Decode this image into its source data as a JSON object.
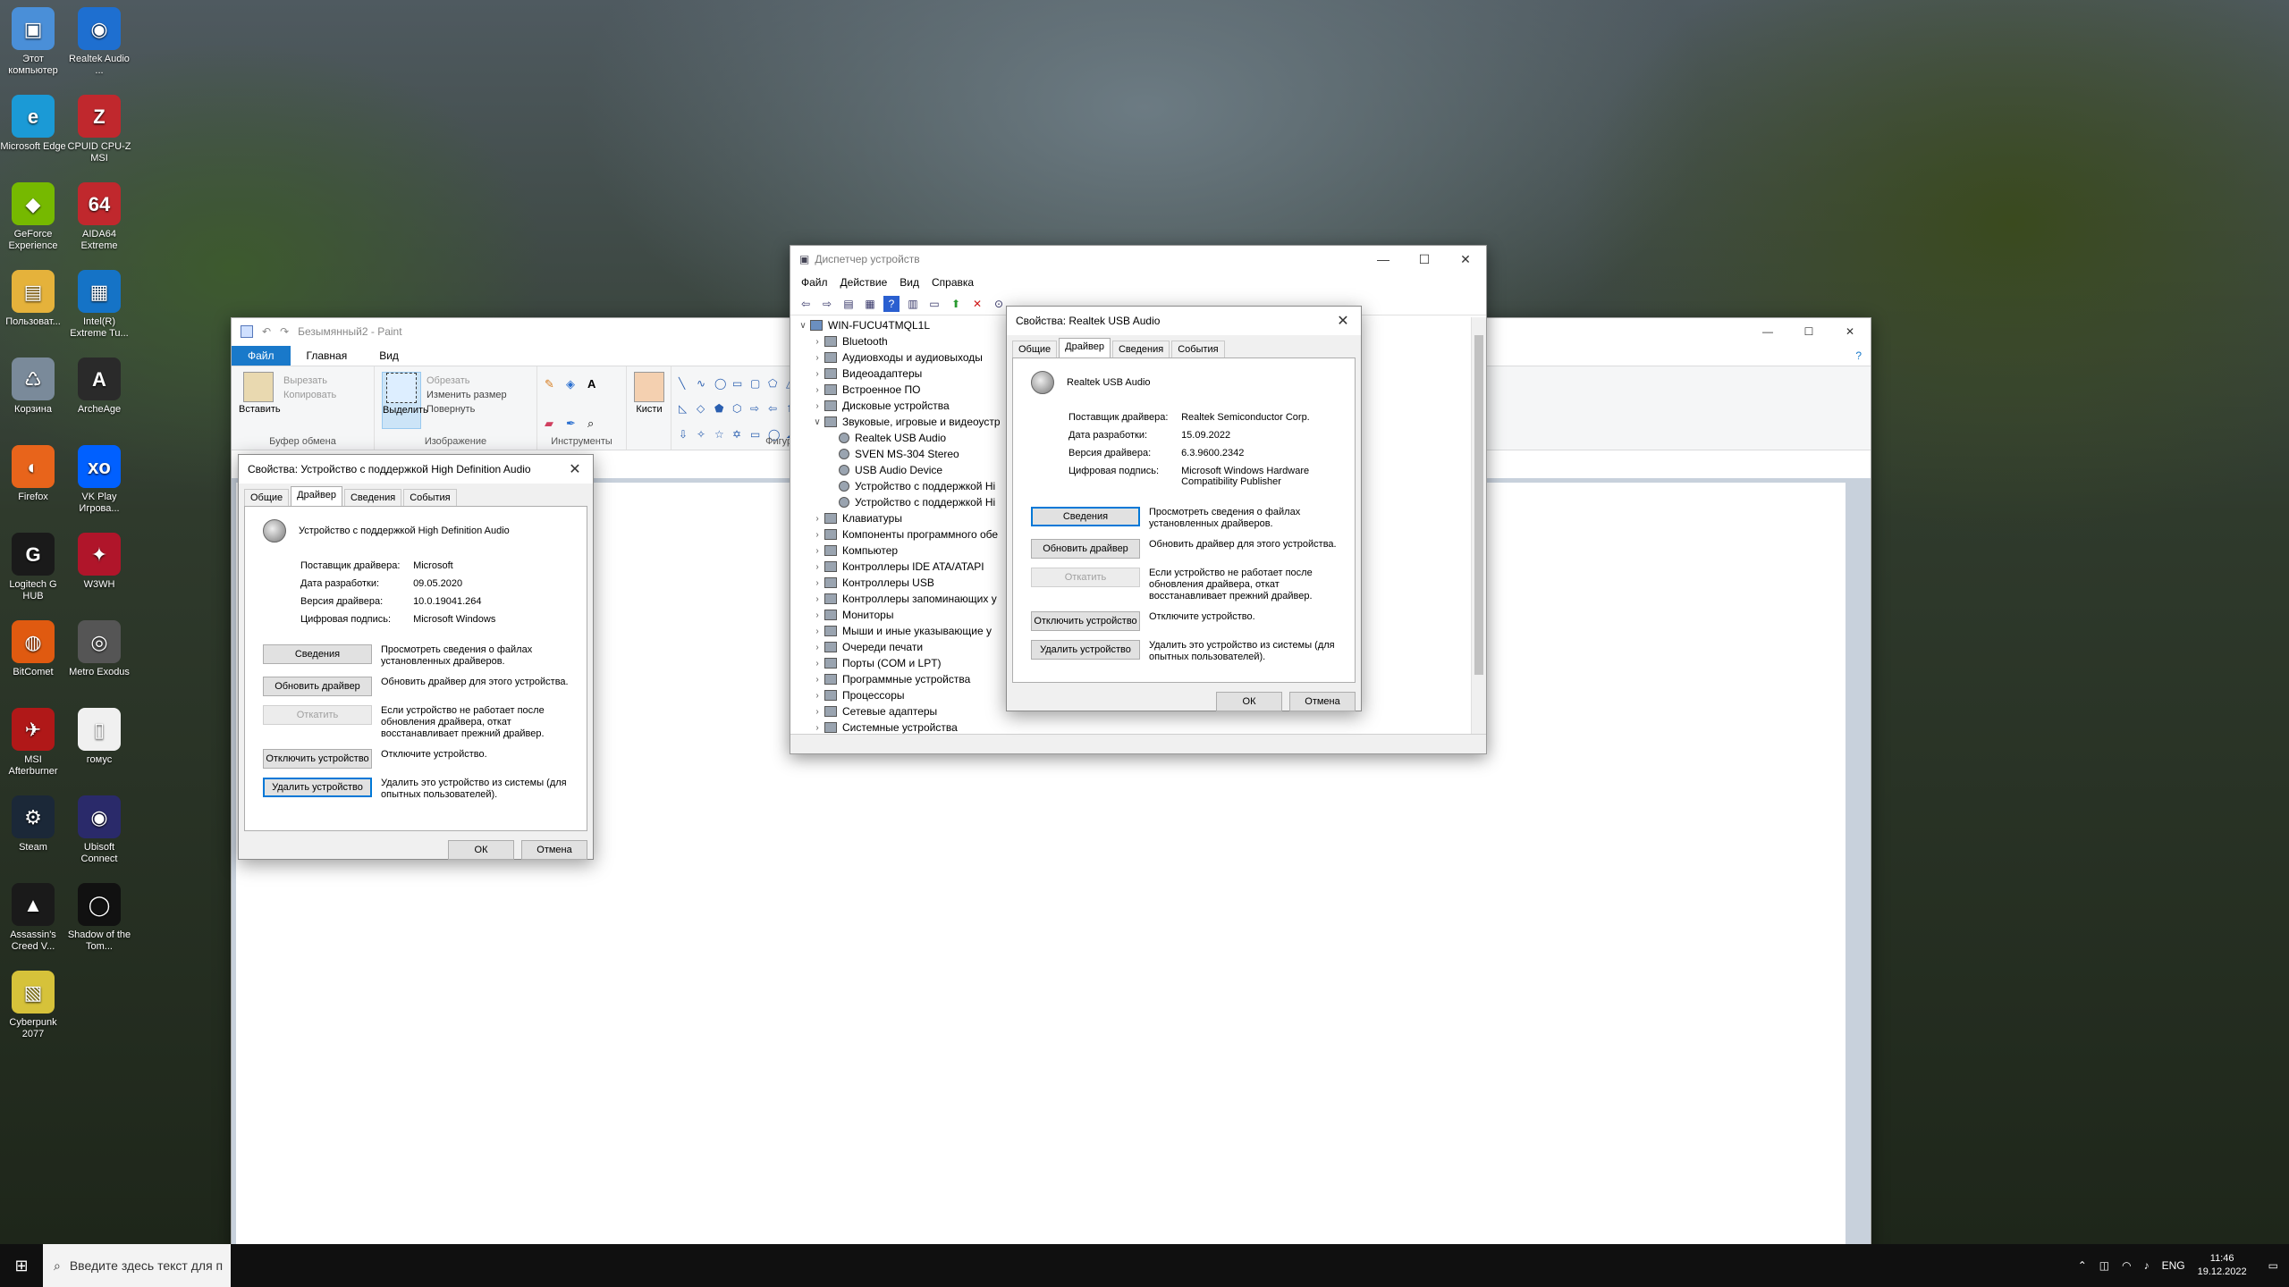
{
  "desktop": {
    "icons": [
      {
        "label": "Этот компьютер",
        "glyph": "▣",
        "color": "#4a8fd8"
      },
      {
        "label": "Realtek Audio ...",
        "glyph": "◉",
        "color": "#1e6fd0"
      },
      {
        "label": "Microsoft Edge",
        "glyph": "e",
        "color": "#1b9ad6"
      },
      {
        "label": "CPUID CPU-Z MSI",
        "glyph": "Z",
        "color": "#c0282d"
      },
      {
        "label": "GeForce Experience",
        "glyph": "◆",
        "color": "#76b900"
      },
      {
        "label": "AIDA64 Extreme",
        "glyph": "64",
        "color": "#c0282d"
      },
      {
        "label": "Пользоват...",
        "glyph": "▤",
        "color": "#e5b23b"
      },
      {
        "label": "Intel(R) Extreme Tu...",
        "glyph": "▦",
        "color": "#1573c6"
      },
      {
        "label": "Корзина",
        "glyph": "♺",
        "color": "#7a8a9a"
      },
      {
        "label": "ArcheAge",
        "glyph": "A",
        "color": "#2a2a2a"
      },
      {
        "label": "Firefox",
        "glyph": "◐",
        "color": "#e8641b"
      },
      {
        "label": "VK Play Игрова...",
        "glyph": "xo",
        "color": "#0060ff"
      },
      {
        "label": "Logitech G HUB",
        "glyph": "G",
        "color": "#1a1a1a"
      },
      {
        "label": "W3WH",
        "glyph": "✦",
        "color": "#b0152a"
      },
      {
        "label": "BitComet",
        "glyph": "◍",
        "color": "#e05a10"
      },
      {
        "label": "Metro Exodus",
        "glyph": "◎",
        "color": "#555"
      },
      {
        "label": "MSI Afterburner",
        "glyph": "✈",
        "color": "#b01818"
      },
      {
        "label": "гомус",
        "glyph": "▯",
        "color": "#f0f0f0"
      },
      {
        "label": "Steam",
        "glyph": "⚙",
        "color": "#1b2838"
      },
      {
        "label": "Ubisoft Connect",
        "glyph": "◉",
        "color": "#2a2a6a"
      },
      {
        "label": "Assassin's Creed V...",
        "glyph": "▲",
        "color": "#1a1a1a"
      },
      {
        "label": "Shadow of the Tom...",
        "glyph": "◯",
        "color": "#111"
      },
      {
        "label": "Cyberpunk 2077",
        "glyph": "▧",
        "color": "#d6c23a"
      }
    ]
  },
  "paint": {
    "title": "Безымянный2 - Paint",
    "tabs": [
      "Файл",
      "Главная",
      "Вид"
    ],
    "groups": {
      "clipboard": {
        "name": "Буфер обмена",
        "paste": "Вставить",
        "cut": "Вырезать",
        "copy": "Копировать"
      },
      "image": {
        "name": "Изображение",
        "select": "Выделить",
        "crop": "Обрезать",
        "resize": "Изменить размер",
        "rotate": "Повернуть"
      },
      "tools": {
        "name": "Инструменты"
      },
      "brushes": {
        "label": "Кисти"
      },
      "shapes": {
        "name": "Фигуры"
      }
    }
  },
  "dialog_hda": {
    "title": "Свойства: Устройство с поддержкой High Definition Audio",
    "tabs": [
      "Общие",
      "Драйвер",
      "Сведения",
      "События"
    ],
    "device_name": "Устройство с поддержкой High Definition Audio",
    "props": [
      {
        "k": "Поставщик драйвера:",
        "v": "Microsoft"
      },
      {
        "k": "Дата разработки:",
        "v": "09.05.2020"
      },
      {
        "k": "Версия драйвера:",
        "v": "10.0.19041.264"
      },
      {
        "k": "Цифровая подпись:",
        "v": "Microsoft Windows"
      }
    ],
    "actions": [
      {
        "btn": "Сведения",
        "desc": "Просмотреть сведения о файлах установленных драйверов."
      },
      {
        "btn": "Обновить драйвер",
        "desc": "Обновить драйвер для этого устройства."
      },
      {
        "btn": "Откатить",
        "desc": "Если устройство не работает после обновления драйвера, откат восстанавливает прежний драйвер."
      },
      {
        "btn": "Отключить устройство",
        "desc": "Отключите устройство."
      },
      {
        "btn": "Удалить устройство",
        "desc": "Удалить это устройство из системы (для опытных пользователей)."
      }
    ],
    "ok": "ОК",
    "cancel": "Отмена"
  },
  "devmgr": {
    "title": "Диспетчер устройств",
    "menu": [
      "Файл",
      "Действие",
      "Вид",
      "Справка"
    ],
    "tree": [
      {
        "label": "WIN-FUCU4TMQL1L",
        "level": 0,
        "chev": "∨"
      },
      {
        "label": "Bluetooth",
        "level": 1,
        "chev": "›"
      },
      {
        "label": "Аудиовходы и аудиовыходы",
        "level": 1,
        "chev": "›"
      },
      {
        "label": "Видеоадаптеры",
        "level": 1,
        "chev": "›"
      },
      {
        "label": "Встроенное ПО",
        "level": 1,
        "chev": "›"
      },
      {
        "label": "Дисковые устройства",
        "level": 1,
        "chev": "›"
      },
      {
        "label": "Звуковые, игровые и видеоустр",
        "level": 1,
        "chev": "∨"
      },
      {
        "label": "Realtek USB Audio",
        "level": 2,
        "chev": ""
      },
      {
        "label": "SVEN MS-304 Stereo",
        "level": 2,
        "chev": ""
      },
      {
        "label": "USB Audio Device",
        "level": 2,
        "chev": ""
      },
      {
        "label": "Устройство с поддержкой Hi",
        "level": 2,
        "chev": ""
      },
      {
        "label": "Устройство с поддержкой Hi",
        "level": 2,
        "chev": ""
      },
      {
        "label": "Клавиатуры",
        "level": 1,
        "chev": "›"
      },
      {
        "label": "Компоненты программного обе",
        "level": 1,
        "chev": "›"
      },
      {
        "label": "Компьютер",
        "level": 1,
        "chev": "›"
      },
      {
        "label": "Контроллеры IDE ATA/ATAPI",
        "level": 1,
        "chev": "›"
      },
      {
        "label": "Контроллеры USB",
        "level": 1,
        "chev": "›"
      },
      {
        "label": "Контроллеры запоминающих у",
        "level": 1,
        "chev": "›"
      },
      {
        "label": "Мониторы",
        "level": 1,
        "chev": "›"
      },
      {
        "label": "Мыши и иные указывающие у",
        "level": 1,
        "chev": "›"
      },
      {
        "label": "Очереди печати",
        "level": 1,
        "chev": "›"
      },
      {
        "label": "Порты (COM и LPT)",
        "level": 1,
        "chev": "›"
      },
      {
        "label": "Программные устройства",
        "level": 1,
        "chev": "›"
      },
      {
        "label": "Процессоры",
        "level": 1,
        "chev": "›"
      },
      {
        "label": "Сетевые адаптеры",
        "level": 1,
        "chev": "›"
      },
      {
        "label": "Системные устройства",
        "level": 1,
        "chev": "›"
      }
    ]
  },
  "dialog_realtek": {
    "title": "Свойства: Realtek USB Audio",
    "tabs": [
      "Общие",
      "Драйвер",
      "Сведения",
      "События"
    ],
    "device_name": "Realtek USB Audio",
    "props": [
      {
        "k": "Поставщик драйвера:",
        "v": "Realtek Semiconductor Corp."
      },
      {
        "k": "Дата разработки:",
        "v": "15.09.2022"
      },
      {
        "k": "Версия драйвера:",
        "v": "6.3.9600.2342"
      },
      {
        "k": "Цифровая подпись:",
        "v": "Microsoft Windows Hardware Compatibility Publisher"
      }
    ],
    "actions": [
      {
        "btn": "Сведения",
        "desc": "Просмотреть сведения о файлах установленных драйверов."
      },
      {
        "btn": "Обновить драйвер",
        "desc": "Обновить драйвер для этого устройства."
      },
      {
        "btn": "Откатить",
        "desc": "Если устройство не работает после обновления драйвера, откат восстанавливает прежний драйвер."
      },
      {
        "btn": "Отключить устройство",
        "desc": "Отключите устройство."
      },
      {
        "btn": "Удалить устройство",
        "desc": "Удалить это устройство из системы (для опытных пользователей)."
      }
    ],
    "ok": "ОК",
    "cancel": "Отмена"
  },
  "taskbar": {
    "search_placeholder": "Введите здесь текст для п",
    "lang": "ENG",
    "time": "11:46",
    "date": "19.12.2022"
  }
}
